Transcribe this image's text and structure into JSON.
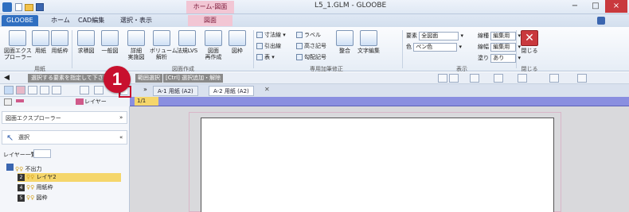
{
  "titlebar": {
    "title": "L5_1.GLM - GLOOBE",
    "context_tab": "ホーム-図面",
    "minimize": "−",
    "maximize": "□",
    "close": "×"
  },
  "tabs": [
    "GLOOBE",
    "ホーム",
    "CAD編集",
    "選択・表示",
    "図面"
  ],
  "ribbon": {
    "btn_explorer": "図面エクス\nプローラー",
    "btn_paper": "用紙",
    "btn_paperframe": "用紙枠",
    "group_paper": "用紙",
    "btn_struct": "求積図",
    "btn_general": "一般図",
    "btn_detail": "詳細\n実施図",
    "btn_volume": "ボリューム\n解析",
    "btn_lvs": "法規LVS",
    "btn_drawing": "図面\n再作成",
    "btn_frame": "図枠",
    "group_create": "図面作成",
    "small_dim": "寸法線",
    "small_label": "ラベル",
    "small_leader": "引出線",
    "small_level": "高さ記号",
    "small_table": "表",
    "small_slope": "勾配記号",
    "btn_align": "整合",
    "btn_text": "文字編集",
    "group_special": "専用加筆修正",
    "disp_element_label": "要素",
    "disp_element_value": "全図面",
    "disp_color_label": "色",
    "disp_color_value": "ペン色",
    "disp_linetype_label": "線種",
    "disp_linetype_value": "編集用",
    "disp_linewidth_label": "線幅",
    "disp_linewidth_value": "編集用",
    "disp_fill_label": "塗り",
    "disp_fill_value": "あり",
    "group_display": "表示",
    "btn_close": "閉じる",
    "group_close": "閉じる"
  },
  "cmdbar": {
    "message": "選択する要素を指定して下さい",
    "hint1": "範囲選択",
    "hint2": "[Ctrl] 選択追加・解除"
  },
  "toolbar": {
    "layer_label": "レイヤー"
  },
  "doctabs": [
    "A-1 用紙 (A2)",
    "A-2 用紙 (A2)"
  ],
  "ruler": {
    "page": "1/1"
  },
  "panel": {
    "title": "図面エクスプローラー",
    "select_label": "選択",
    "layerlist_label": "レイヤー一覧",
    "layers": [
      {
        "num": "",
        "name": "不出力"
      },
      {
        "num": "2",
        "name": "レイヤ2"
      },
      {
        "num": "4",
        "name": "用紙枠"
      },
      {
        "num": "5",
        "name": "図枠"
      }
    ]
  },
  "callout": {
    "number": "1"
  },
  "colors": {
    "accent": "#2f6fc1",
    "callout": "#c8102e",
    "ruler": "#8a8fe0"
  }
}
